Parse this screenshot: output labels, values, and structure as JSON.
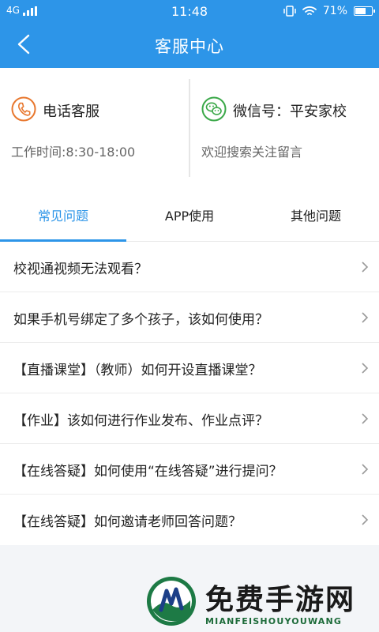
{
  "status_bar": {
    "network": "4G",
    "time": "11:48",
    "battery": "71%",
    "battery_level": 0.71
  },
  "header": {
    "title": "客服中心"
  },
  "service": {
    "phone": {
      "name": "电话客服",
      "detail": "工作时间:8:30-18:00",
      "icon": "phone-icon",
      "color": "#e8772e"
    },
    "wechat": {
      "name": "微信号：平安家校",
      "detail": "欢迎搜索关注留言",
      "icon": "wechat-icon",
      "color": "#3aa848"
    }
  },
  "tabs": [
    {
      "label": "常见问题",
      "active": true
    },
    {
      "label": "APP使用",
      "active": false
    },
    {
      "label": "其他问题",
      "active": false
    }
  ],
  "faq": [
    "校视通视频无法观看？",
    "如果手机号绑定了多个孩子，该如何使用？",
    "【直播课堂】（教师）如何开设直播课堂？",
    "【作业】该如何进行作业发布、作业点评？",
    "【在线答疑】如何使用“在线答疑”进行提问？",
    "【在线答疑】如何邀请老师回答问题？"
  ],
  "watermark": {
    "title": "免费手游网",
    "subtitle": "MIANFEISHOUYOUWANG"
  },
  "colors": {
    "primary": "#2d95e8",
    "background": "#f3f5f8"
  }
}
